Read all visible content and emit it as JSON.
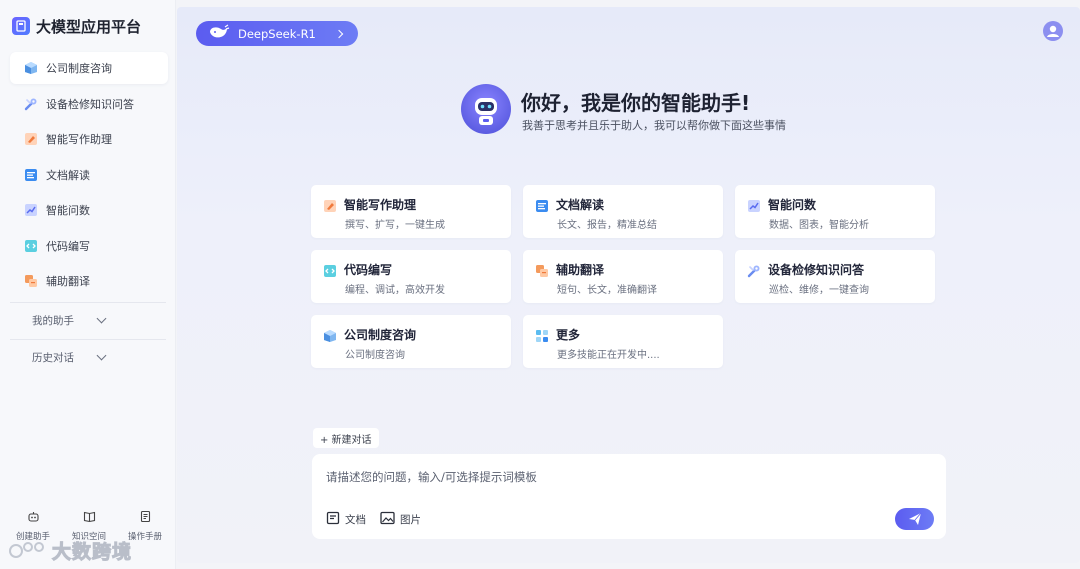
{
  "app": {
    "title": "大模型应用平台"
  },
  "sidebar": {
    "items": [
      {
        "label": "公司制度咨询",
        "icon": "building-icon",
        "active": true
      },
      {
        "label": "设备检修知识问答",
        "icon": "wrench-icon"
      },
      {
        "label": "智能写作助理",
        "icon": "pen-icon"
      },
      {
        "label": "文档解读",
        "icon": "document-icon"
      },
      {
        "label": "智能问数",
        "icon": "chart-icon"
      },
      {
        "label": "代码编写",
        "icon": "code-icon"
      },
      {
        "label": "辅助翻译",
        "icon": "translate-icon"
      }
    ],
    "groups": [
      {
        "label": "我的助手"
      },
      {
        "label": "历史对话"
      }
    ],
    "tools": [
      {
        "label": "创建助手",
        "icon": "robot-icon"
      },
      {
        "label": "知识空间",
        "icon": "book-icon"
      },
      {
        "label": "操作手册",
        "icon": "manual-icon"
      }
    ],
    "watermark": "大数跨境"
  },
  "header": {
    "model_label": "DeepSeek-R1",
    "model_icon": "whale-icon"
  },
  "hero": {
    "title": "你好，我是你的智能助手!",
    "subtitle": "我善于思考并且乐于助人，我可以帮你做下面这些事情"
  },
  "cards": [
    {
      "title": "智能写作助理",
      "desc": "撰写、扩写，一键生成",
      "icon": "pen-icon"
    },
    {
      "title": "文档解读",
      "desc": "长文、报告，精准总结",
      "icon": "document-icon"
    },
    {
      "title": "智能问数",
      "desc": "数据、图表，智能分析",
      "icon": "chart-icon"
    },
    {
      "title": "代码编写",
      "desc": "编程、调试，高效开发",
      "icon": "code-icon"
    },
    {
      "title": "辅助翻译",
      "desc": "短句、长文，准确翻译",
      "icon": "translate-icon"
    },
    {
      "title": "设备检修知识问答",
      "desc": "巡检、维修，一键查询",
      "icon": "wrench-icon"
    },
    {
      "title": "公司制度咨询",
      "desc": "公司制度咨询",
      "icon": "building-icon"
    },
    {
      "title": "更多",
      "desc": "更多技能正在开发中....",
      "icon": "grid-icon"
    }
  ],
  "composer": {
    "new_chat_label": "+ 新建对话",
    "placeholder": "请描述您的问题，输入/可选择提示词模板",
    "value": "",
    "attach_doc_label": "文档",
    "attach_image_label": "图片"
  },
  "colors": {
    "accent": "#5b5cf0",
    "sidebar_bg": "#f7f8fb",
    "main_bg": "#e9ecf8"
  }
}
